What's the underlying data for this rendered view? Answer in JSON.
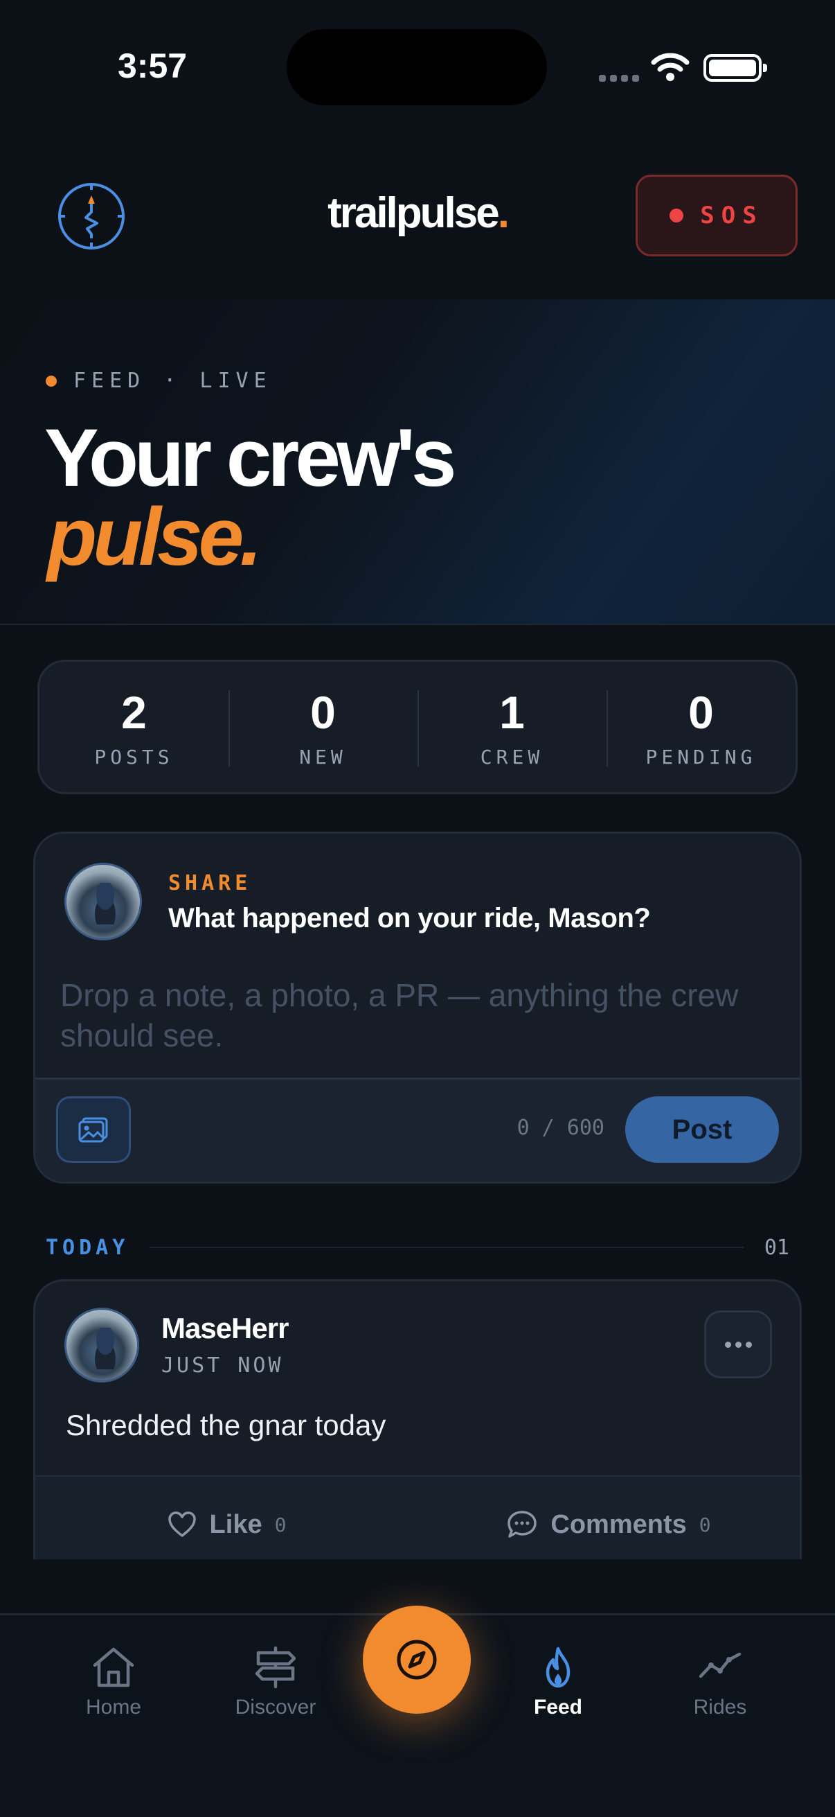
{
  "status_bar": {
    "time": "3:57"
  },
  "header": {
    "brand_name": "trailpulse",
    "brand_dot": ".",
    "sos_label": "SOS"
  },
  "hero": {
    "tag": "FEED · LIVE",
    "title": "Your crew's",
    "subtitle": "pulse."
  },
  "stats": [
    {
      "value": "2",
      "label": "POSTS"
    },
    {
      "value": "0",
      "label": "NEW"
    },
    {
      "value": "1",
      "label": "CREW"
    },
    {
      "value": "0",
      "label": "PENDING"
    }
  ],
  "composer": {
    "label": "SHARE",
    "question": "What happened on your ride, Mason?",
    "placeholder": "Drop a note, a photo, a PR — anything the crew should see.",
    "value": "",
    "char_count": "0 / 600",
    "post_label": "Post"
  },
  "section": {
    "title": "TODAY",
    "count": "01"
  },
  "posts": [
    {
      "author": "MaseHerr",
      "time": "JUST NOW",
      "body": "Shredded the gnar today",
      "like_label": "Like",
      "like_count": "0",
      "comments_label": "Comments",
      "comments_count": "0"
    }
  ],
  "tabs": [
    {
      "label": "Home",
      "icon": "home-icon"
    },
    {
      "label": "Discover",
      "icon": "signpost-icon"
    },
    {
      "label": "Feed",
      "icon": "flame-icon",
      "active": true
    },
    {
      "label": "Rides",
      "icon": "trend-line-icon"
    }
  ],
  "fab": {
    "icon": "compass-icon"
  },
  "colors": {
    "accent": "#f28a2e",
    "blue": "#4a90e2",
    "background": "#0c1118",
    "card": "#161d27",
    "sos": "#ef4444"
  }
}
